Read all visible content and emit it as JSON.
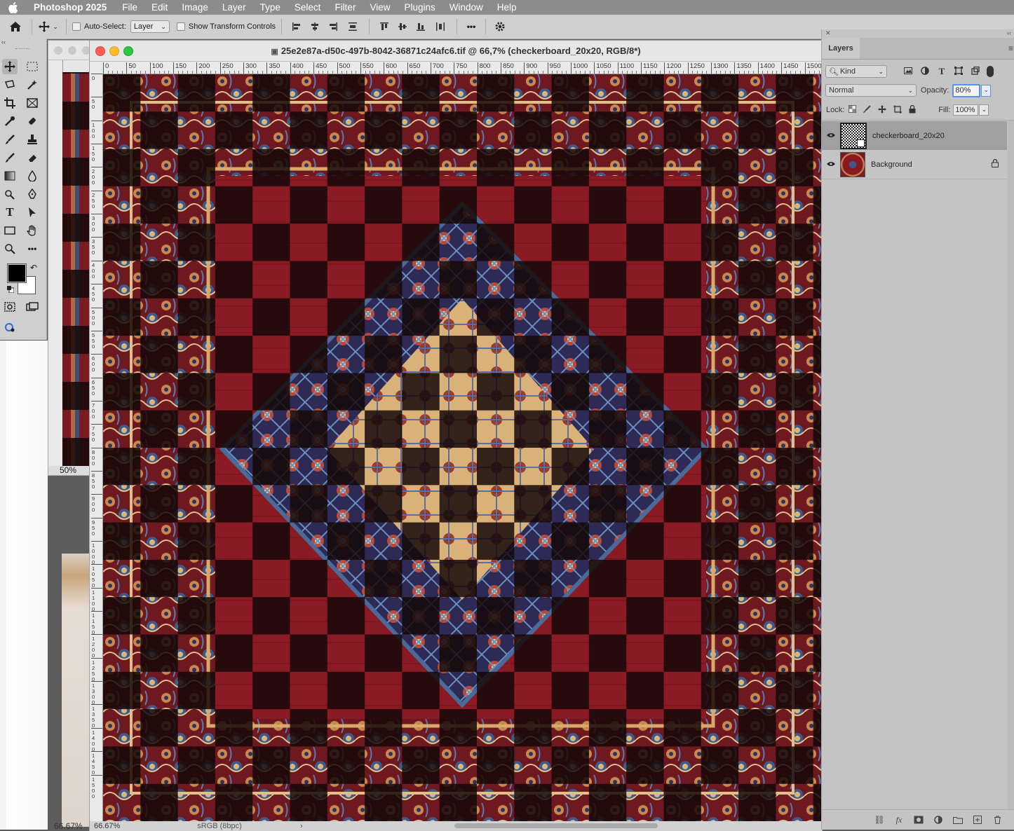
{
  "menubar": {
    "app_name": "Photoshop 2025",
    "items": [
      "File",
      "Edit",
      "Image",
      "Layer",
      "Type",
      "Select",
      "Filter",
      "View",
      "Plugins",
      "Window",
      "Help"
    ]
  },
  "options_bar": {
    "auto_select_label": "Auto-Select:",
    "auto_select_target": "Layer",
    "show_transform_label": "Show Transform Controls",
    "more_label": "•••"
  },
  "document": {
    "title": "25e2e87a-d50c-497b-8042-36871c24afc6.tif @ 66,7% (checkerboard_20x20, RGB/8*)",
    "zoom": "66.67%",
    "color_profile": "sRGB (8bpc)",
    "ruler_ticks": [
      "0",
      "50",
      "100",
      "150",
      "200",
      "250",
      "300",
      "350",
      "400",
      "450",
      "500",
      "550",
      "600",
      "650",
      "700",
      "750",
      "800",
      "850",
      "900",
      "950",
      "1000",
      "1050",
      "1100",
      "1150",
      "1200",
      "1250",
      "1300",
      "1350",
      "1400",
      "1450",
      "1500"
    ]
  },
  "background_window": {
    "zoom": "50%",
    "zoom_bottom": "66.67%"
  },
  "layers_panel": {
    "tab_label": "Layers",
    "filter_kind": "Kind",
    "blend_mode": "Normal",
    "opacity_label": "Opacity:",
    "opacity_value": "80%",
    "lock_label": "Lock:",
    "fill_label": "Fill:",
    "fill_value": "100%",
    "layers": [
      {
        "name": "checkerboard_20x20",
        "selected": true,
        "locked": false
      },
      {
        "name": "Background",
        "selected": false,
        "locked": true
      }
    ]
  },
  "colors": {
    "menubar": "#8c8c8c",
    "panel": "#c4c4c4",
    "rug_red": "#8a1a22",
    "rug_dark": "#1a0b0b",
    "rug_cream": "#d7b27a",
    "rug_blue": "#4a6a9a"
  }
}
